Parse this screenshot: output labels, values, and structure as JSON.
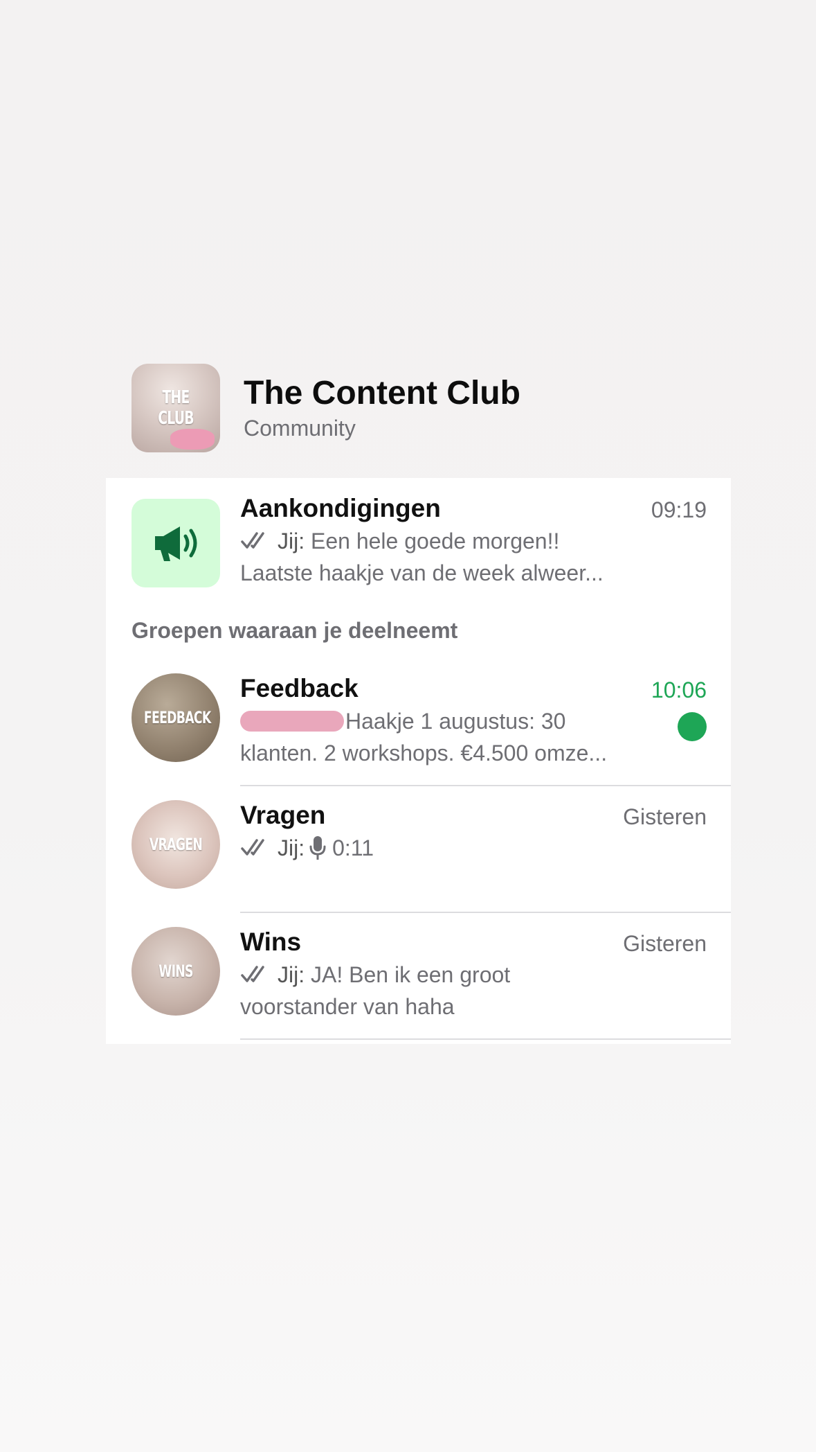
{
  "community": {
    "name": "The Content Club",
    "subtitle": "Community",
    "avatar_text": "THE CLUB"
  },
  "announcements": {
    "title": "Aankondigingen",
    "time": "09:19",
    "sender": "Jij:",
    "message_line1": "Een hele goede morgen!!",
    "message_line2": "Laatste haakje van de week alweer...",
    "icon": "megaphone-icon"
  },
  "groups_section_label": "Groepen waaraan je deelneemt",
  "groups": [
    {
      "title": "Feedback",
      "time": "10:06",
      "avatar_text": "FEEDBACK",
      "message_line1": "Haakje 1 augustus:  30",
      "message_line2": "klanten. 2 workshops. €4.500 omze...",
      "unread": true
    },
    {
      "title": "Vragen",
      "time": "Gisteren",
      "avatar_text": "VRAGEN",
      "sender": "Jij:",
      "voice_duration": "0:11"
    },
    {
      "title": "Wins",
      "time": "Gisteren",
      "avatar_text": "WINS",
      "sender": "Jij:",
      "message_line1": "JA! Ben ik een groot",
      "message_line2": "voorstander van haha"
    }
  ],
  "colors": {
    "accent_green": "#1ea656",
    "announce_bg": "#d4fcd9",
    "announce_icon": "#0f6b3b",
    "secondary_text": "#6e6e73",
    "redaction": "#e9a7bb"
  }
}
